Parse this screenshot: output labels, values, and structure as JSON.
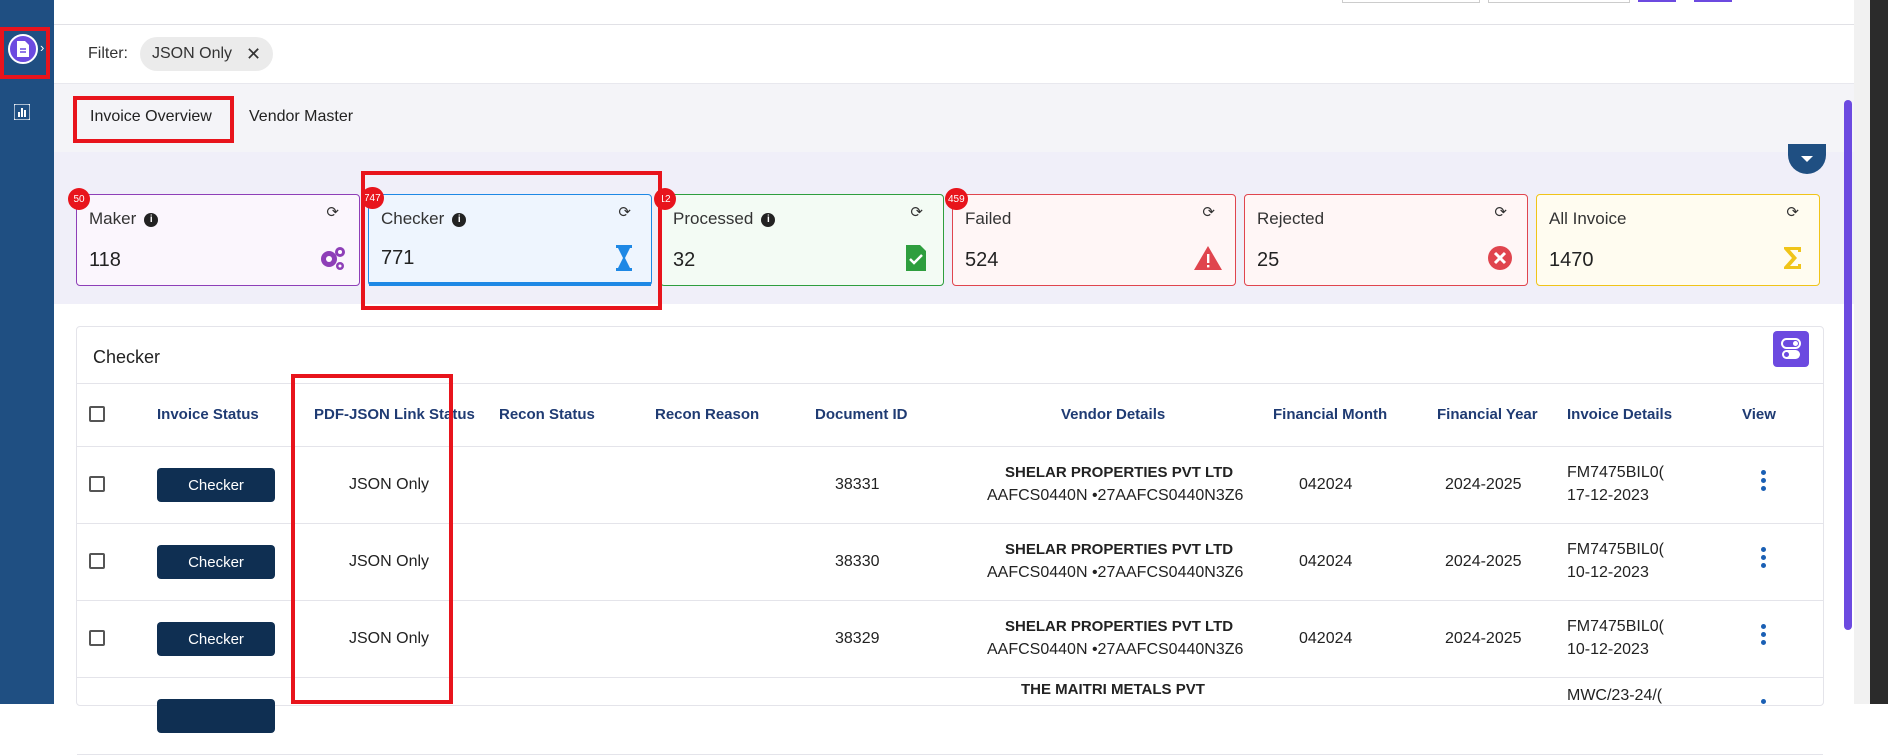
{
  "filter": {
    "label": "Filter:",
    "chip": "JSON Only"
  },
  "tabs": [
    "Invoice Overview",
    "Vendor Master"
  ],
  "cards": [
    {
      "title": "Maker",
      "value": "118",
      "badge": "50",
      "color": "#8e3fb8",
      "bg": "#fbf6fd",
      "icon": "gears-icon",
      "info": true
    },
    {
      "title": "Checker",
      "value": "771",
      "badge": "747",
      "color": "#1e88e5",
      "bg": "#eef5fe",
      "icon": "hourglass-icon",
      "info": true
    },
    {
      "title": "Processed",
      "value": "32",
      "badge": "12",
      "color": "#2e9e3e",
      "bg": "#f3fbf4",
      "icon": "doc-check-icon",
      "info": true
    },
    {
      "title": "Failed",
      "value": "524",
      "badge": "459",
      "color": "#e0454e",
      "bg": "#fff6f6",
      "icon": "warning-icon",
      "info": false
    },
    {
      "title": "Rejected",
      "value": "25",
      "badge": "",
      "color": "#e0454e",
      "bg": "#fff6f6",
      "icon": "cancel-icon",
      "info": false
    },
    {
      "title": "All Invoice",
      "value": "1470",
      "badge": "",
      "color": "#f0c419",
      "bg": "#fffcf0",
      "icon": "sigma-icon",
      "info": false
    }
  ],
  "table": {
    "title": "Checker",
    "columns": [
      "Invoice Status",
      "PDF-JSON Link Status",
      "Recon Status",
      "Recon Reason",
      "Document ID",
      "Vendor Details",
      "Financial Month",
      "Financial Year",
      "Invoice Details",
      "View"
    ],
    "rows": [
      {
        "status": "Checker",
        "link": "JSON Only",
        "doc_id": "38331",
        "vendor_name": "SHELAR PROPERTIES PVT LTD",
        "vendor_ids": "AAFCS0440N  •27AAFCS0440N3Z6",
        "month": "042024",
        "year": "2024-2025",
        "inv_no": "FM7475BIL0(",
        "inv_date": "17-12-2023"
      },
      {
        "status": "Checker",
        "link": "JSON Only",
        "doc_id": "38330",
        "vendor_name": "SHELAR PROPERTIES PVT LTD",
        "vendor_ids": "AAFCS0440N  •27AAFCS0440N3Z6",
        "month": "042024",
        "year": "2024-2025",
        "inv_no": "FM7475BIL0(",
        "inv_date": "10-12-2023"
      },
      {
        "status": "Checker",
        "link": "JSON Only",
        "doc_id": "38329",
        "vendor_name": "SHELAR PROPERTIES PVT LTD",
        "vendor_ids": "AAFCS0440N  •27AAFCS0440N3Z6",
        "month": "042024",
        "year": "2024-2025",
        "inv_no": "FM7475BIL0(",
        "inv_date": "10-12-2023"
      },
      {
        "status": "",
        "link": "",
        "doc_id": "",
        "vendor_name": "THE MAITRI METALS PVT",
        "vendor_ids": "",
        "month": "",
        "year": "",
        "inv_no": "MWC/23-24/(",
        "inv_date": ""
      }
    ]
  }
}
